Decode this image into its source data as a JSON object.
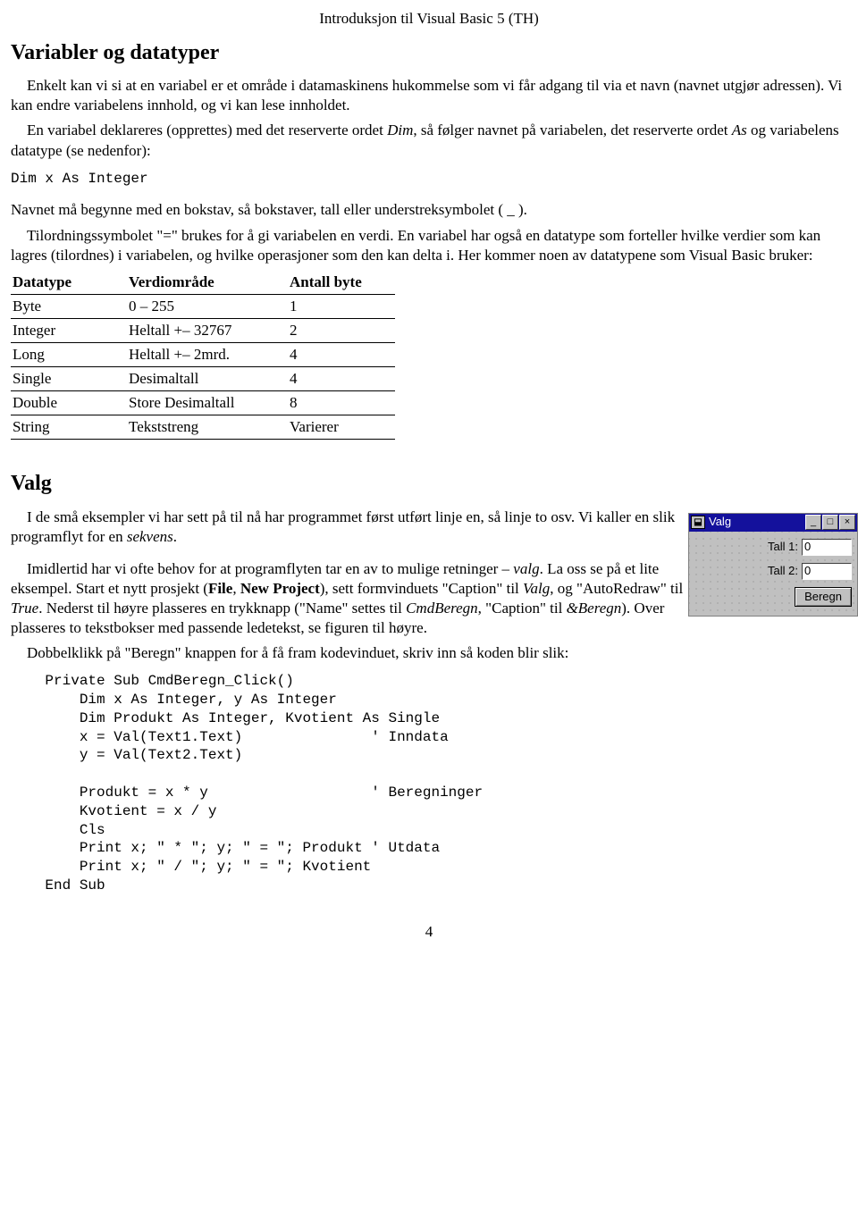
{
  "header": {
    "title": "Introduksjon til Visual Basic 5 (TH)"
  },
  "section1": {
    "heading": "Variabler og datatyper",
    "p1a": "Enkelt kan vi si at en variabel er et område i datamaskinens hukommelse som vi får adgang til via et navn (navnet utgjør adressen). Vi kan endre variabelens innhold, og vi kan lese innholdet.",
    "p1b_pre": "En variabel deklareres (opprettes) med det reserverte ordet ",
    "p1b_dim": "Dim",
    "p1b_mid": ", så følger navnet på variabelen, det reserverte ordet ",
    "p1b_as": "As",
    "p1b_post": " og variabelens datatype (se nedenfor):",
    "code1": "Dim x As Integer",
    "p2a": "Navnet må begynne med en bokstav, så bokstaver, tall eller understreksymbolet ( _ ).",
    "p2b": "Tilordningssymbolet \"=\" brukes for å gi variabelen en verdi. En variabel har også en datatype som forteller hvilke verdier som kan lagres (tilordnes) i variabelen, og hvilke operasjoner som den kan delta i. Her kommer noen av datatypene som Visual Basic bruker:",
    "table": {
      "headers": [
        "Datatype",
        "Verdiområde",
        "Antall byte"
      ],
      "rows": [
        [
          "Byte",
          "0 – 255",
          "1"
        ],
        [
          "Integer",
          "Heltall +– 32767",
          "2"
        ],
        [
          "Long",
          "Heltall +– 2mrd.",
          "4"
        ],
        [
          "Single",
          "Desimaltall",
          "4"
        ],
        [
          "Double",
          "Store Desimaltall",
          "8"
        ],
        [
          "String",
          "Tekststreng",
          "Varierer"
        ]
      ]
    }
  },
  "section2": {
    "heading": "Valg",
    "p1_pre": "I de små eksempler vi har sett på til nå har programmet først utført linje en, så linje to osv. Vi kaller en slik programflyt for en ",
    "p1_em": "sekvens",
    "p1_post": ".",
    "p2_pre": "Imidlertid har vi ofte behov for at programflyten tar en av to mulige retninger – ",
    "p2_em": "valg",
    "p2_mid": ". La oss se på et lite eksempel. Start et nytt prosjekt (",
    "p2_b1": "File",
    "p2_c1": ", ",
    "p2_b2": "New Project",
    "p2_mid2": "), sett formvinduets \"Caption\" til ",
    "p2_em2": "Valg",
    "p2_mid3": ", og \"AutoRedraw\" til ",
    "p2_em3": "True",
    "p2_mid4": ". Nederst til høyre plasseres en trykknapp (\"Name\" settes til ",
    "p2_em4": "CmdBeregn",
    "p2_mid5": ", \"Caption\" til ",
    "p2_em5": "&Beregn",
    "p2_post": "). Over plasseres to tekstbokser med passende ledetekst, se figuren til høyre.",
    "p3": "Dobbelklikk på \"Beregn\" knappen for å få fram kodevinduet, skriv inn så koden blir slik:",
    "code": "    Private Sub CmdBeregn_Click()\n        Dim x As Integer, y As Integer\n        Dim Produkt As Integer, Kvotient As Single\n        x = Val(Text1.Text)               ' Inndata\n        y = Val(Text2.Text)\n\n        Produkt = x * y                   ' Beregninger\n        Kvotient = x / y\n        Cls\n        Print x; \" * \"; y; \" = \"; Produkt ' Utdata\n        Print x; \" / \"; y; \" = \"; Kvotient\n    End Sub"
  },
  "figure": {
    "title": "Valg",
    "label1": "Tall 1:",
    "value1": "0",
    "label2": "Tall 2:",
    "value2": "0",
    "button": "Beregn"
  },
  "page_number": "4"
}
